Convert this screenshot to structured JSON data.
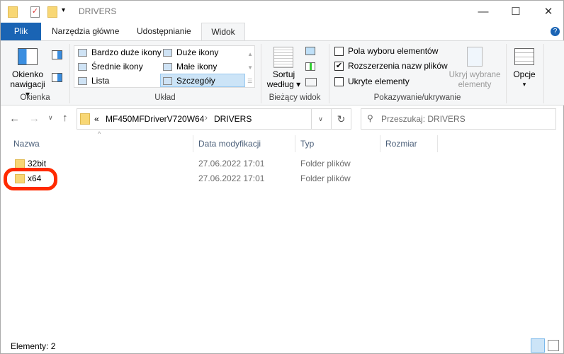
{
  "window": {
    "title": "DRIVERS",
    "minimize": "—",
    "maximize": "☐",
    "close": "✕"
  },
  "tabs": [
    {
      "label": "Plik"
    },
    {
      "label": "Narzędzia główne"
    },
    {
      "label": "Udostępnianie"
    },
    {
      "label": "Widok"
    }
  ],
  "ribbon": {
    "panes": {
      "nav_pane": "Okienko",
      "nav_pane2": "nawigacji",
      "group": "Okienka"
    },
    "layout": {
      "items": [
        "Bardzo duże ikony",
        "Duże ikony",
        "Średnie ikony",
        "Małe ikony",
        "Lista",
        "Szczegóły"
      ],
      "selected": "Szczegóły",
      "group": "Układ"
    },
    "current_view": {
      "sort": "Sortuj",
      "sort2": "według",
      "group": "Bieżący widok"
    },
    "show_hide": {
      "item_checkboxes": "Pola wyboru elementów",
      "file_ext": "Rozszerzenia nazw plików",
      "hidden": "Ukryte elementy",
      "hide_selected": "Ukryj wybrane",
      "hide_selected2": "elementy",
      "group": "Pokazywanie/ukrywanie",
      "checked": [
        false,
        true,
        false
      ]
    },
    "options": "Opcje"
  },
  "address": {
    "prefix": "«",
    "crumbs": [
      "MF450MFDriverV720W64",
      "DRIVERS"
    ],
    "search_placeholder": "Przeszukaj: DRIVERS"
  },
  "columns": [
    "Nazwa",
    "Data modyfikacji",
    "Typ",
    "Rozmiar"
  ],
  "files": [
    {
      "name": "32bit",
      "date": "27.06.2022 17:01",
      "type": "Folder plików",
      "size": ""
    },
    {
      "name": "x64",
      "date": "27.06.2022 17:01",
      "type": "Folder plików",
      "size": ""
    }
  ],
  "highlight_color": "#ff2a00",
  "status": {
    "count": "Elementy: 2"
  }
}
